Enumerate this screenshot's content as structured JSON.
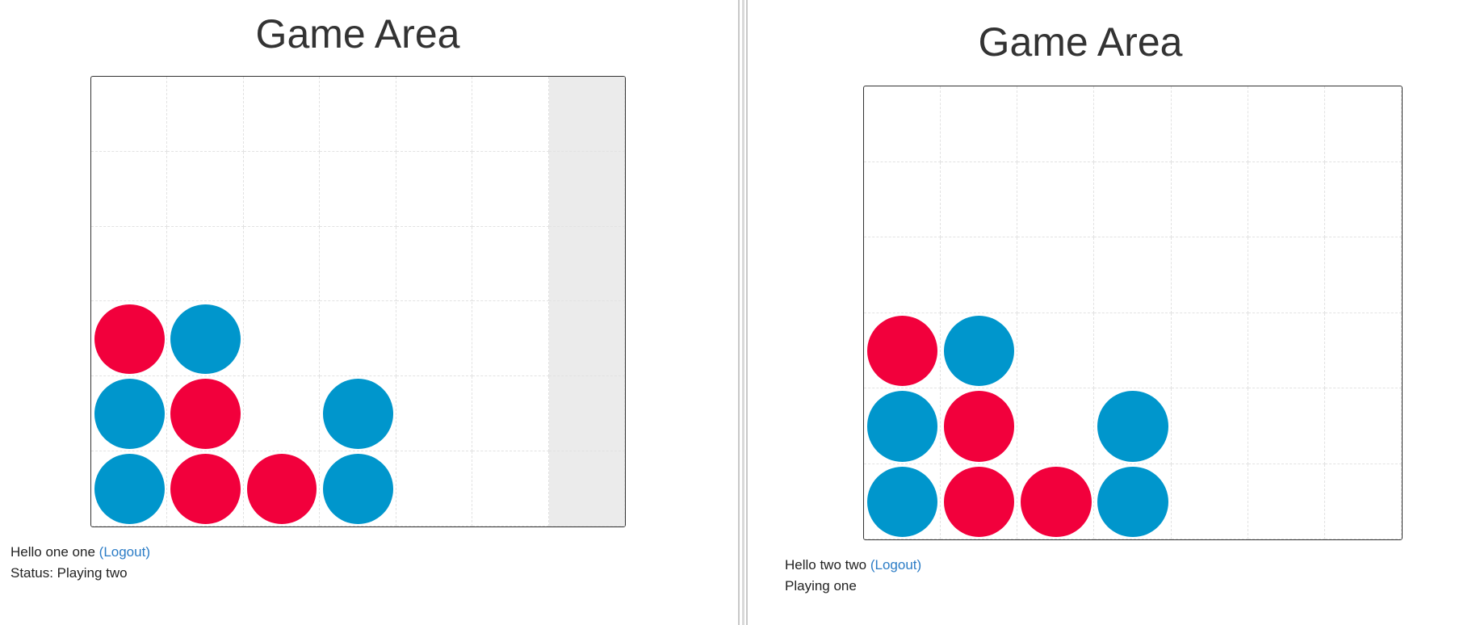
{
  "colors": {
    "player_one_disc": "#f2003c",
    "player_two_disc": "#0096cc",
    "board_border": "#333333",
    "grid_line": "#e2e2e2",
    "hover_column": "#ebebeb",
    "link": "#2b7cc6"
  },
  "grid": {
    "columns": 7,
    "rows": 6
  },
  "left_window": {
    "title": "Game Area",
    "greeting": "Hello one one",
    "logout_label": "(Logout)",
    "status": "Status: Playing two",
    "highlighted_column": 7
  },
  "right_window": {
    "title": "Game Area",
    "greeting": "Hello two two",
    "logout_label": "(Logout)",
    "status": "Playing one",
    "highlighted_column": null
  },
  "board_discs": [
    {
      "col": 1,
      "row": 4,
      "color": "red"
    },
    {
      "col": 2,
      "row": 4,
      "color": "blue"
    },
    {
      "col": 1,
      "row": 5,
      "color": "blue"
    },
    {
      "col": 2,
      "row": 5,
      "color": "red"
    },
    {
      "col": 4,
      "row": 5,
      "color": "blue"
    },
    {
      "col": 1,
      "row": 6,
      "color": "blue"
    },
    {
      "col": 2,
      "row": 6,
      "color": "red"
    },
    {
      "col": 3,
      "row": 6,
      "color": "red"
    },
    {
      "col": 4,
      "row": 6,
      "color": "blue"
    }
  ]
}
